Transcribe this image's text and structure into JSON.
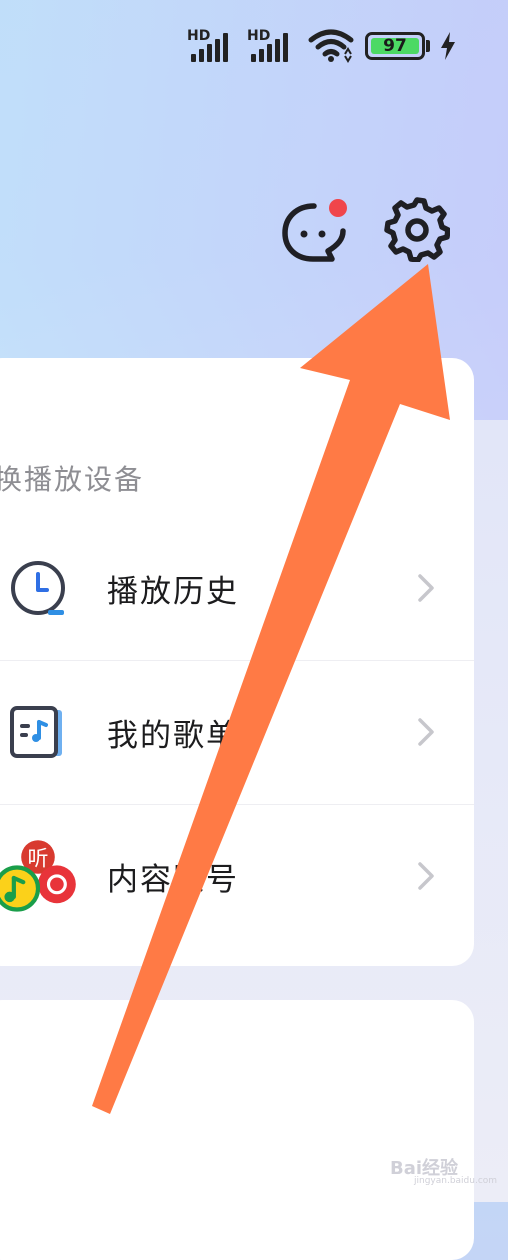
{
  "status_bar": {
    "sim1_label": "HD",
    "sim2_label": "HD",
    "battery_level": "97",
    "battery_color": "#4cd964"
  },
  "header": {
    "message_icon": "chat-bubble-icon",
    "message_badge_color": "#f0454b",
    "settings_icon": "gear-icon"
  },
  "main_card": {
    "section_label": "换播放设备",
    "items": [
      {
        "label": "播放历史",
        "icon": "clock-history-icon"
      },
      {
        "label": "我的歌单",
        "icon": "playlist-icon"
      },
      {
        "label": "内容账号",
        "icon": "content-accounts-icon"
      }
    ]
  },
  "annotation": {
    "arrow_color": "#ff7a45"
  },
  "watermark": {
    "text": "Bai经验",
    "sub": "jingyan.baidu.com"
  }
}
